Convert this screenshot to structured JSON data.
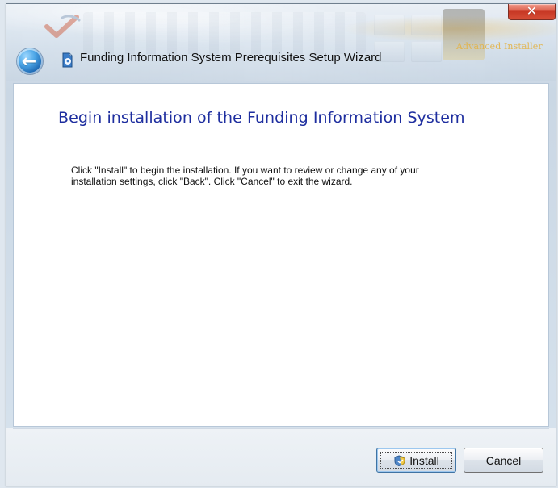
{
  "window": {
    "title": "Funding Information System Prerequisites Setup Wizard",
    "brand": "Advanced Installer",
    "close_icon": "close-icon"
  },
  "content": {
    "heading": "Begin installation of the Funding Information System",
    "instructions": "Click \"Install\" to begin the installation.  If you want to review or change any of your\ninstallation settings, click \"Back\".  Click \"Cancel\" to exit the wizard."
  },
  "buttons": {
    "install": {
      "label": "Install",
      "icon": "install-shield-icon"
    },
    "cancel": {
      "label": "Cancel"
    }
  },
  "icons": {
    "back": "back-arrow-icon",
    "app": "app-icon"
  },
  "colors": {
    "heading": "#1e2e9f",
    "close_button": "#c63724",
    "focus_button_border": "#3f73a3"
  }
}
